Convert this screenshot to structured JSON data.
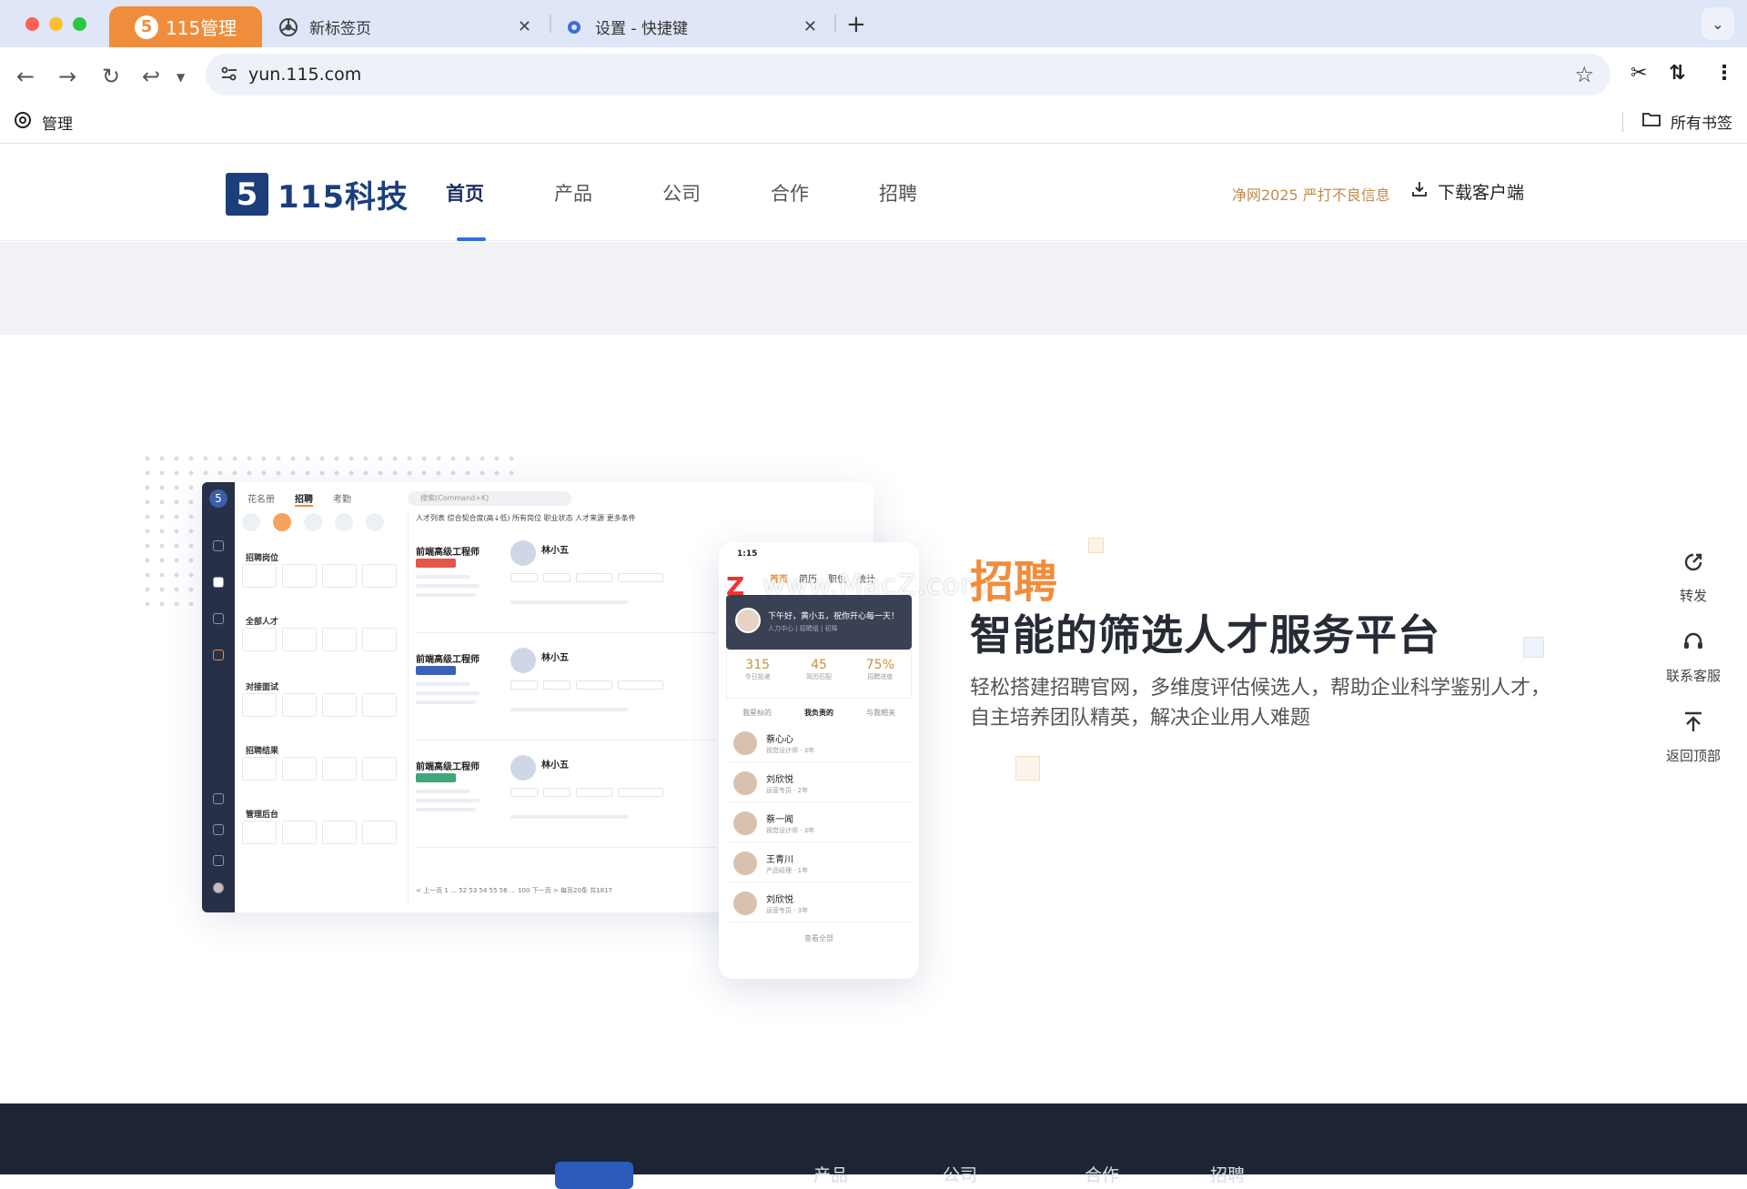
{
  "browser": {
    "tabs": [
      {
        "label": "115管理",
        "active": true
      },
      {
        "label": "新标签页",
        "active": false
      },
      {
        "label": "设置 - 快捷键",
        "active": false
      }
    ],
    "url": "yun.115.com",
    "bookmark_left": "管理",
    "bookmark_right": "所有书签",
    "accent": "#f08d3c"
  },
  "site": {
    "logo_mark": "5",
    "logo_text": "115科技",
    "nav": [
      "首页",
      "产品",
      "公司",
      "合作",
      "招聘"
    ],
    "notice": "净网2025 严打不良信息",
    "download": "下载客户端"
  },
  "hero": {
    "kicker": "招聘",
    "title": "智能的筛选人才服务平台",
    "description": "轻松搭建招聘官网，多维度评估候选人，帮助企业科学鉴别人才，自主培养团队精英，解决企业用人难题"
  },
  "mockup": {
    "tabs": [
      "花名册",
      "招聘",
      "考勤"
    ],
    "search_placeholder": "搜索(Command+K)",
    "sections": [
      "招聘岗位",
      "全部人才",
      "对接面试",
      "招聘结果",
      "管理后台"
    ],
    "filter": "人才列表   综合契合度(高↓低)   所有岗位   职业状态   人才来源   更多条件",
    "card_title": "前端高级工程师",
    "candidate": "林小五",
    "pager": "< 上一页  1 … 52 53 54 55 56 … 100  下一页 >   每页20条   共1817"
  },
  "phone": {
    "time": "1:15",
    "nav": [
      "首页",
      "简历",
      "职位",
      "统计"
    ],
    "greeting": "下午好，黄小五，祝你开心每一天！",
    "greeting_sub": "人力中心 | 招聘组 | 初降",
    "stats": [
      {
        "value": "315",
        "label": "今日投递"
      },
      {
        "value": "45",
        "label": "简历匹配"
      },
      {
        "value": "75%",
        "label": "招聘进度"
      }
    ],
    "segments": [
      "我星标的",
      "我负责的",
      "与我相关"
    ],
    "people": [
      {
        "name": "蔡心心",
        "role": "视觉设计师 · 3年"
      },
      {
        "name": "刘欣悦",
        "role": "运营专员 · 2年"
      },
      {
        "name": "蔡一闻",
        "role": "视觉设计师 · 3年"
      },
      {
        "name": "王青川",
        "role": "产品经理 · 1年"
      },
      {
        "name": "刘欣悦",
        "role": "运营专员 · 3年"
      }
    ],
    "more": "查看全部"
  },
  "watermark": "www.MacZ.com",
  "side_float": [
    "转发",
    "联系客服",
    "返回顶部"
  ],
  "footer_nav": [
    "产品",
    "公司",
    "合作",
    "招聘"
  ]
}
